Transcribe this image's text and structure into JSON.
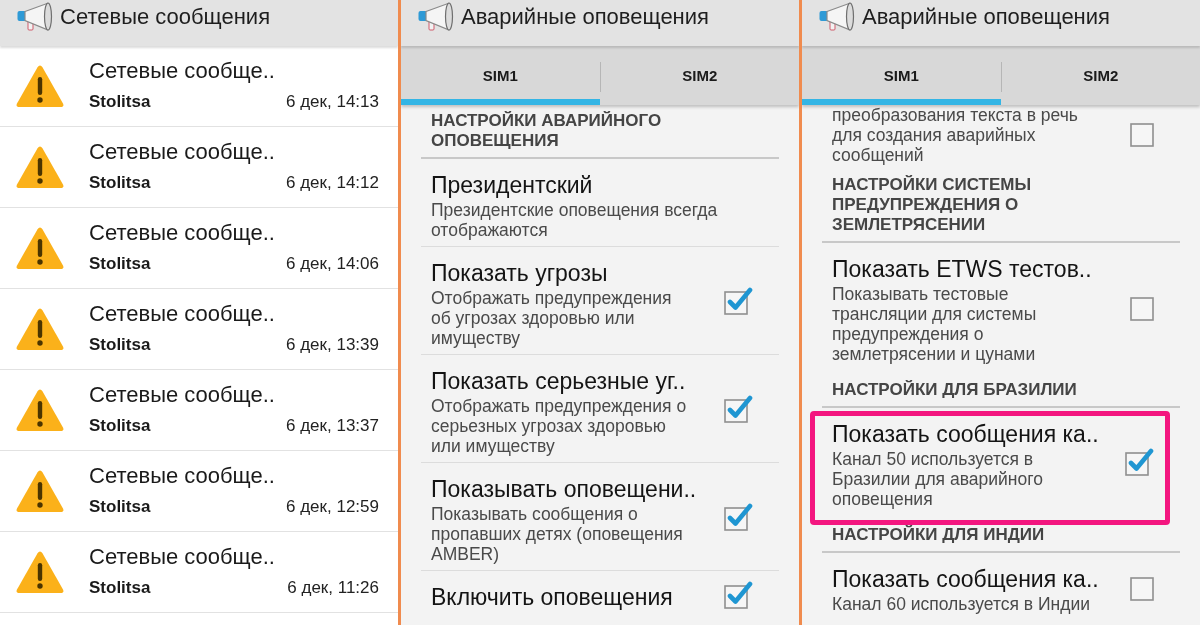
{
  "panels": [
    {
      "kind": "messages",
      "title": "Сетевые сообщения",
      "messages": [
        {
          "title": "Сетевые сообще..",
          "sender": "Stolitsa",
          "time": "6 дек, 14:13"
        },
        {
          "title": "Сетевые сообще..",
          "sender": "Stolitsa",
          "time": "6 дек, 14:12"
        },
        {
          "title": "Сетевые сообще..",
          "sender": "Stolitsa",
          "time": "6 дек, 14:06"
        },
        {
          "title": "Сетевые сообще..",
          "sender": "Stolitsa",
          "time": "6 дек, 13:39"
        },
        {
          "title": "Сетевые сообще..",
          "sender": "Stolitsa",
          "time": "6 дек, 13:37"
        },
        {
          "title": "Сетевые сообще..",
          "sender": "Stolitsa",
          "time": "6 дек, 12:59"
        },
        {
          "title": "Сетевые сообще..",
          "sender": "Stolitsa",
          "time": "6 дек, 11:26"
        }
      ]
    },
    {
      "kind": "settings",
      "title": "Аварийные оповещения",
      "tabs": [
        {
          "label": "SIM1",
          "selected": true
        },
        {
          "label": "SIM2",
          "selected": false
        }
      ],
      "entries": [
        {
          "kind": "section",
          "title": "НАСТРОЙКИ АВАРИЙНОГО\nОПОВЕЩЕНИЯ"
        },
        {
          "kind": "info",
          "title": "Президентский",
          "summary": "Президентские оповещения всегда\nотображаются",
          "highlighted": false
        },
        {
          "kind": "checkbox",
          "title": "Показать угрозы",
          "summary": "Отображать предупреждения\nоб угрозах здоровью или\nимуществу",
          "checked": true,
          "highlighted": false
        },
        {
          "kind": "checkbox",
          "title": "Показать серьезные уг..",
          "summary": "Отображать предупреждения о\nсерьезных угрозах здоровью\nили имуществу",
          "checked": true,
          "highlighted": false
        },
        {
          "kind": "checkbox",
          "title": "Показывать оповещени..",
          "summary": "Показывать сообщения о\nпропавших детях (оповещения\nAMBER)",
          "checked": true,
          "highlighted": false
        },
        {
          "kind": "checkbox",
          "title": "Включить оповещения",
          "checked": true,
          "highlighted": false
        }
      ]
    },
    {
      "kind": "settings",
      "title": "Аварийные оповещения",
      "tabs": [
        {
          "label": "SIM1",
          "selected": true
        },
        {
          "label": "SIM2",
          "selected": false
        }
      ],
      "entries": [
        {
          "kind": "checkbox",
          "summary": "преобразования текста в речь\nдля создания аварийных\nсообщений",
          "checked": false,
          "highlighted": false
        },
        {
          "kind": "section",
          "title": "НАСТРОЙКИ СИСТЕМЫ\nПРЕДУПРЕЖДЕНИЯ О\nЗЕМЛЕТРЯСЕНИИ"
        },
        {
          "kind": "checkbox",
          "title": "Показать ETWS тестов..",
          "summary": "Показывать тестовые\nтрансляции для системы\nпредупреждения о\nземлетрясении и цунами",
          "checked": false,
          "highlighted": false
        },
        {
          "kind": "section",
          "title": "НАСТРОЙКИ ДЛЯ БРАЗИЛИИ"
        },
        {
          "kind": "checkbox",
          "title": "Показать сообщения ка..",
          "summary": "Канал 50 используется в\nБразилии для аварийного\nоповещения",
          "checked": true,
          "highlighted": true
        },
        {
          "kind": "section",
          "title": "НАСТРОЙКИ ДЛЯ ИНДИИ"
        },
        {
          "kind": "checkbox",
          "title": "Показать сообщения ка..",
          "summary": "Канал 60 используется в Индии",
          "checked": false,
          "highlighted": false
        }
      ]
    }
  ]
}
